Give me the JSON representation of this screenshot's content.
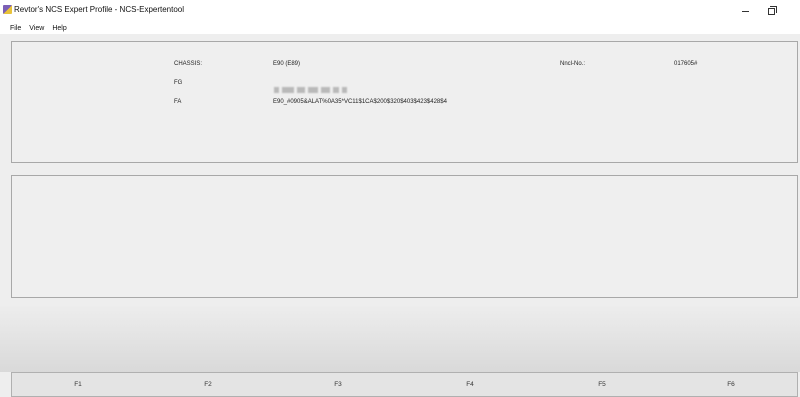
{
  "window": {
    "title": "Revtor's NCS Expert Profile - NCS-Expertentool",
    "icon": "app-icon"
  },
  "menu": {
    "items": [
      "File",
      "View",
      "Help"
    ]
  },
  "vehicle_info": {
    "chassis_label": "CHASSIS:",
    "chassis_value": "E90 (E89)",
    "fg_label": "FG",
    "fa_label": "FA",
    "fa_value": "E90_#0905&ALAT%0A35*VC11$1CA$200$320$403$423$428$4",
    "nncl_label": "Nncl-No.:",
    "nncl_value": "017605#"
  },
  "function_keys": [
    "F1",
    "F2",
    "F3",
    "F4",
    "F5",
    "F6"
  ]
}
